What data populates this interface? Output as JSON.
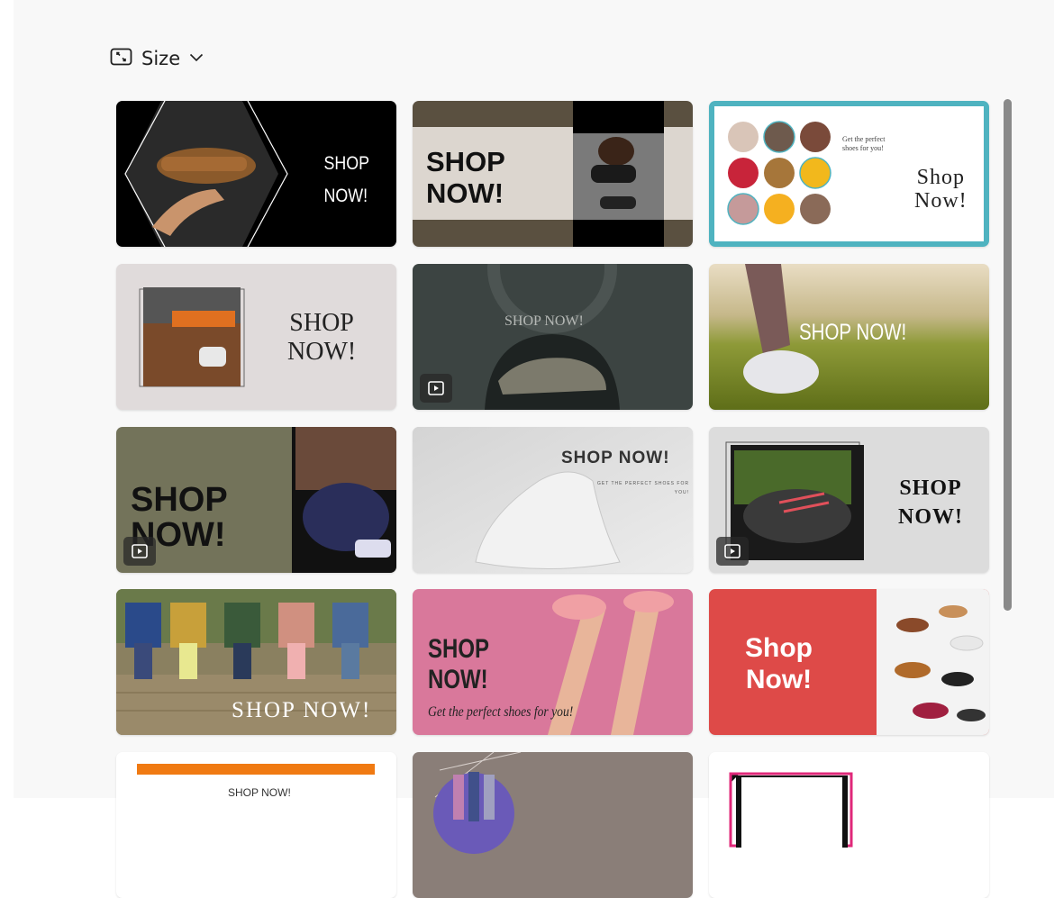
{
  "toolbar": {
    "size_label": "Size",
    "size_icon": "resize-icon",
    "chevron_icon": "chevron-down-icon"
  },
  "templates": [
    {
      "headline_1": "SHOP",
      "headline_2": "NOW!"
    },
    {
      "headline_1": "SHOP",
      "headline_2": "NOW!"
    },
    {
      "headline_1": "Shop",
      "headline_2": "Now!",
      "tagline_1": "Get the perfect",
      "tagline_2": "shoes for you!"
    },
    {
      "headline_1": "SHOP",
      "headline_2": "NOW!"
    },
    {
      "headline": "SHOP NOW!",
      "video": true
    },
    {
      "headline": "SHOP NOW!"
    },
    {
      "headline_1": "SHOP",
      "headline_2": "NOW!",
      "video": true
    },
    {
      "headline": "SHOP NOW!",
      "tagline_1": "GET THE PERFECT SHOES FOR",
      "tagline_2": "YOU!"
    },
    {
      "headline_1": "SHOP",
      "headline_2": "NOW!",
      "video": true
    },
    {
      "headline": "SHOP NOW!"
    },
    {
      "headline_1": "SHOP",
      "headline_2": "NOW!",
      "tagline": "Get the perfect shoes for you!"
    },
    {
      "headline_1": "Shop",
      "headline_2": "Now!"
    },
    {
      "headline": "SHOP NOW!"
    },
    {},
    {}
  ],
  "colors": {
    "accent_teal": "#4fb3c0",
    "orange": "#f07a12",
    "red": "#de4a48",
    "pink": "#d9789b",
    "olive": "#73735a"
  }
}
